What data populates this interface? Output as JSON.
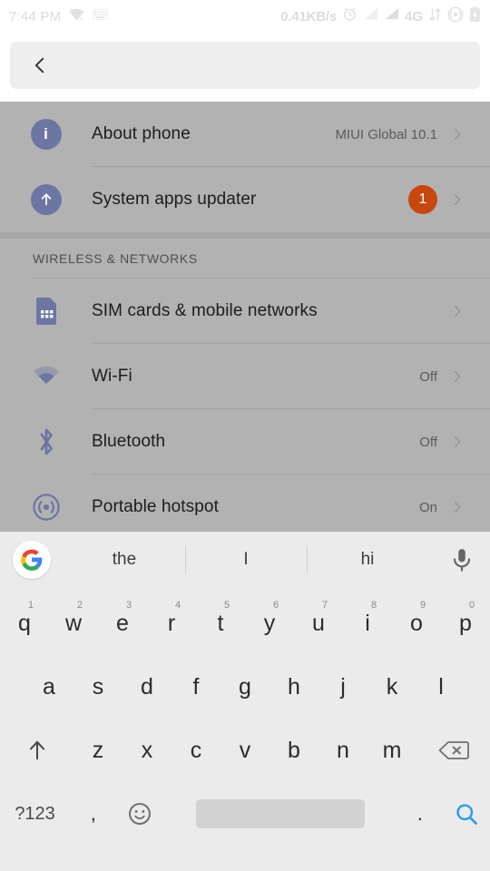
{
  "status_bar": {
    "time": "7:44 PM",
    "left_icons": [
      "wifi-off-icon",
      "keyboard-icon"
    ],
    "network_speed": "0.41KB/s",
    "network_type": "4G",
    "right_icons": [
      "alarm-icon",
      "signal-no-sim-icon",
      "signal-bars-icon",
      "data-transfer-icon",
      "hotspot-icon",
      "battery-charging-icon"
    ]
  },
  "search": {
    "value": "",
    "placeholder": "",
    "back_icon": "back-chevron-icon"
  },
  "settings": {
    "groups": [
      {
        "header": "",
        "rows": [
          {
            "icon": "info-icon",
            "label": "About phone",
            "value": "MIUI Global 10.1",
            "badge": "",
            "chevron": true
          },
          {
            "icon": "up-arrow-icon",
            "label": "System apps updater",
            "value": "",
            "badge": "1",
            "chevron": true
          }
        ]
      },
      {
        "header": "WIRELESS & NETWORKS",
        "rows": [
          {
            "icon": "sim-card-icon",
            "label": "SIM cards & mobile networks",
            "value": "",
            "badge": "",
            "chevron": true
          },
          {
            "icon": "wifi-icon",
            "label": "Wi-Fi",
            "value": "Off",
            "badge": "",
            "chevron": true
          },
          {
            "icon": "bluetooth-icon",
            "label": "Bluetooth",
            "value": "Off",
            "badge": "",
            "chevron": true
          },
          {
            "icon": "hotspot-icon",
            "label": "Portable hotspot",
            "value": "On",
            "badge": "",
            "chevron": true
          }
        ]
      }
    ]
  },
  "keyboard": {
    "logo": "google-g-icon",
    "suggestions": [
      "the",
      "I",
      "hi"
    ],
    "mic_icon": "microphone-icon",
    "row1": [
      {
        "key": "q",
        "sup": "1"
      },
      {
        "key": "w",
        "sup": "2"
      },
      {
        "key": "e",
        "sup": "3"
      },
      {
        "key": "r",
        "sup": "4"
      },
      {
        "key": "t",
        "sup": "5"
      },
      {
        "key": "y",
        "sup": "6"
      },
      {
        "key": "u",
        "sup": "7"
      },
      {
        "key": "i",
        "sup": "8"
      },
      {
        "key": "o",
        "sup": "9"
      },
      {
        "key": "p",
        "sup": "0"
      }
    ],
    "row2": [
      "a",
      "s",
      "d",
      "f",
      "g",
      "h",
      "j",
      "k",
      "l"
    ],
    "row3": [
      "z",
      "x",
      "c",
      "v",
      "b",
      "n",
      "m"
    ],
    "shift_icon": "shift-arrow-icon",
    "backspace_icon": "backspace-icon",
    "symbols_label": "?123",
    "comma_label": ",",
    "emoji_icon": "emoji-smiley-icon",
    "space_label": "",
    "period_label": ".",
    "search_icon": "search-magnifier-icon"
  },
  "colors": {
    "badge": "#c8470f",
    "icon_circle": "#6c76a2",
    "scrim": "#b0b0b0",
    "keyboard_bg": "#ebebeb",
    "search_accent": "#3b9aea"
  }
}
